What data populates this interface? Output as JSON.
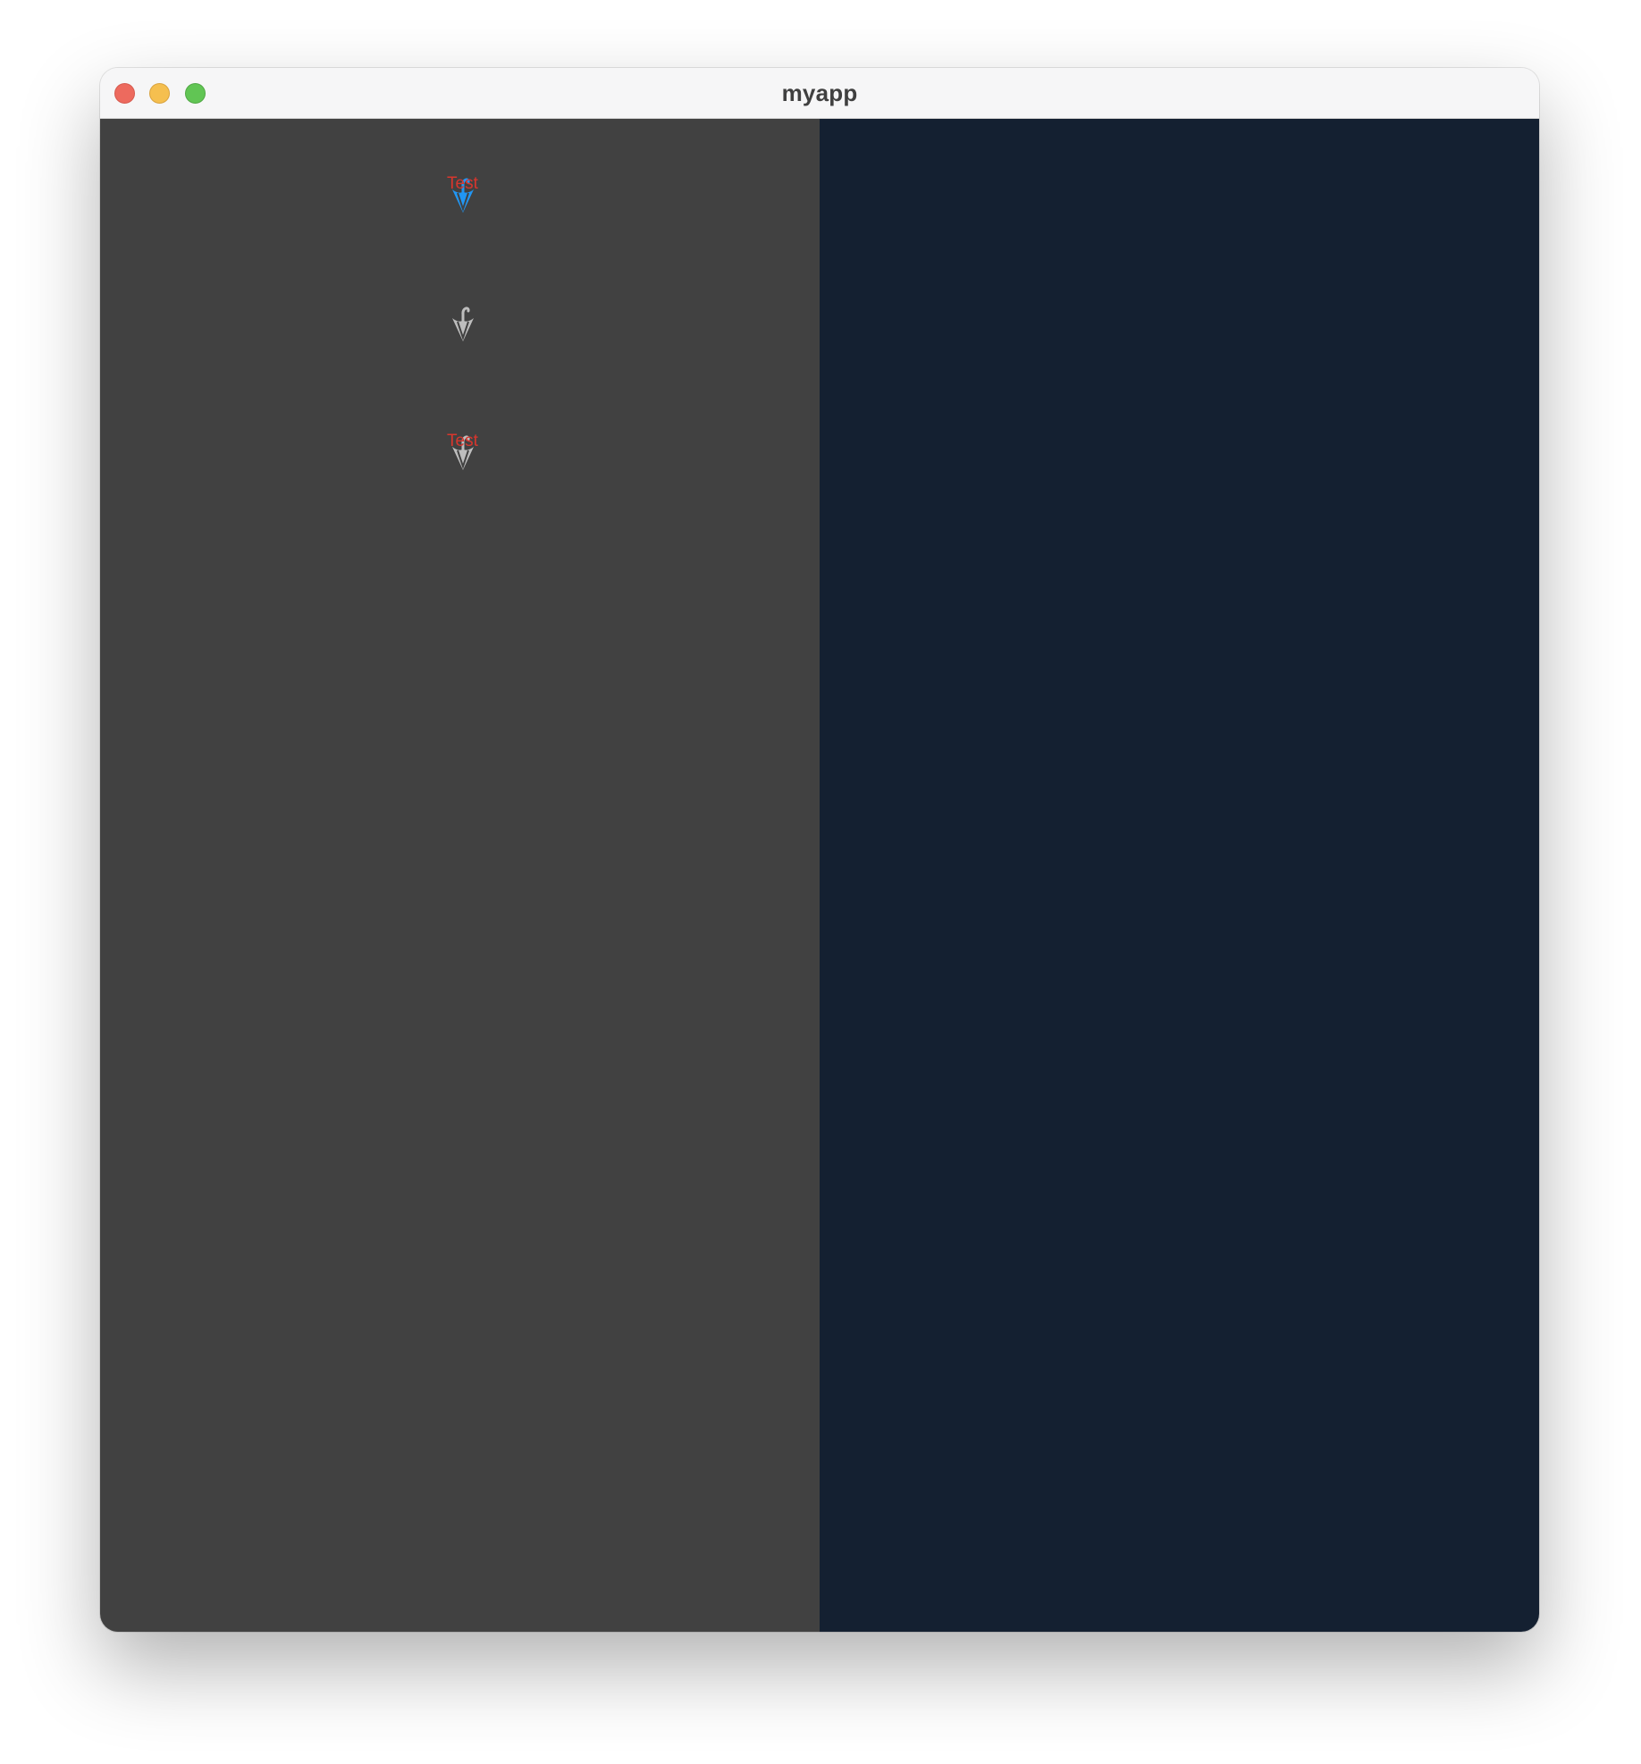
{
  "window": {
    "title": "myapp"
  },
  "left_pane": {
    "color": "#414141",
    "items": [
      {
        "icon": "umbrella-icon",
        "icon_color": "#2196f3",
        "label": "Test",
        "label_color": "#d8362d",
        "state": "selected"
      },
      {
        "icon": "umbrella-icon",
        "icon_color": "#bdbdbd",
        "label": "",
        "state": "normal"
      },
      {
        "icon": "umbrella-icon",
        "icon_color": "#bdbdbd",
        "label": "Test",
        "label_color": "#d8362d",
        "state": "normal"
      }
    ]
  },
  "right_pane": {
    "color": "#142031"
  }
}
